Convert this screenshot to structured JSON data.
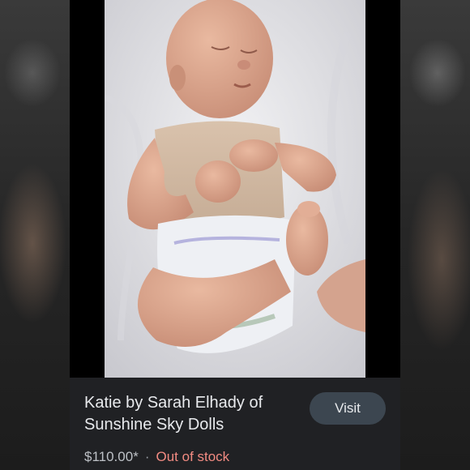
{
  "product": {
    "title": "Katie by Sarah Elhady of Sunshine Sky Dolls",
    "price": "$110.00*",
    "separator": "·",
    "stock_status": "Out of stock"
  },
  "actions": {
    "visit_label": "Visit"
  },
  "colors": {
    "card_background": "#202124",
    "visit_button": "#3c4650",
    "stock_status": "#f28b82",
    "title_text": "#e8eaed"
  }
}
